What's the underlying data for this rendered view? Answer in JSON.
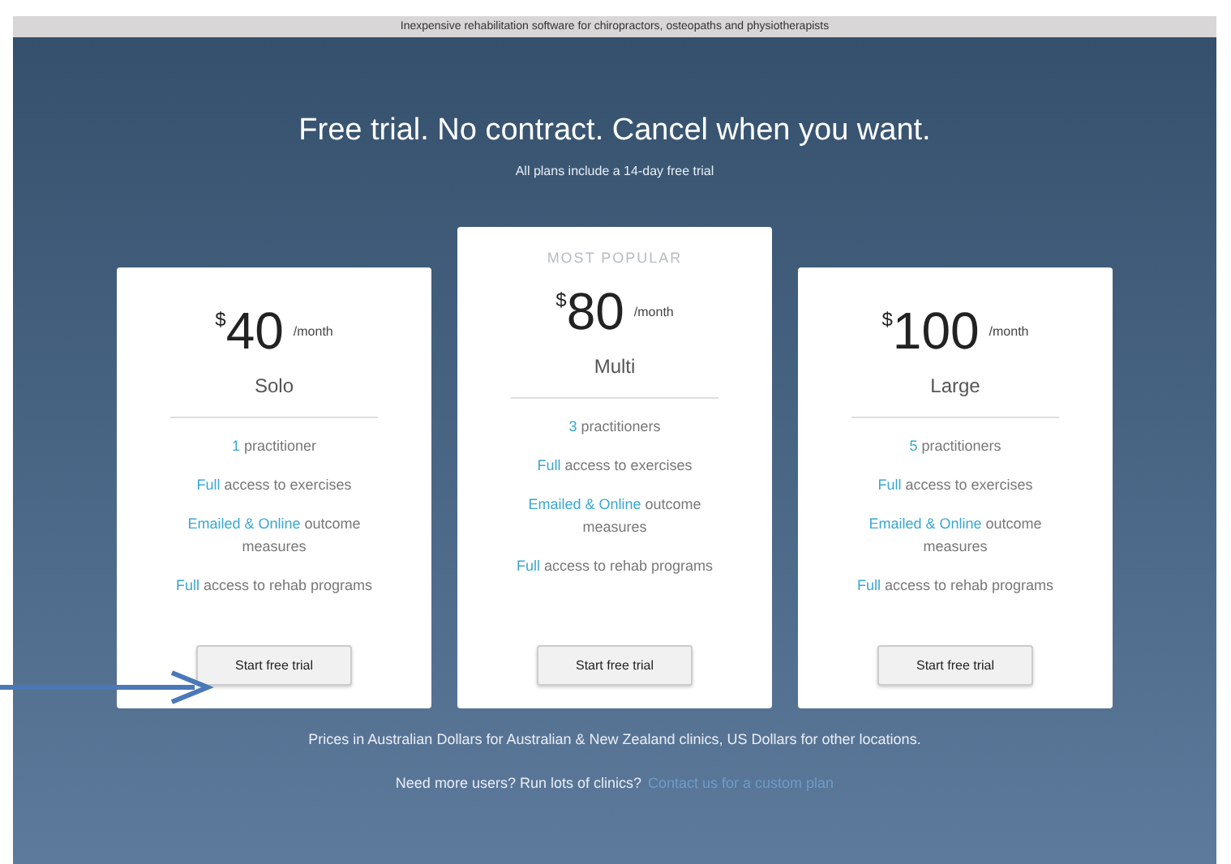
{
  "banner": {
    "text": "Inexpensive rehabilitation software for chiropractors, osteopaths and physiotherapists"
  },
  "hero": {
    "title": "Free trial. No contract. Cancel when you want.",
    "subtitle": "All plans include a 14-day free trial"
  },
  "plans": [
    {
      "currency": "$",
      "price": "40",
      "period": "/month",
      "name": "Solo",
      "featured": false,
      "features": [
        [
          {
            "text": "1",
            "highlight": true
          },
          {
            "text": " practitioner",
            "highlight": false
          }
        ],
        [
          {
            "text": "Full",
            "highlight": true
          },
          {
            "text": " access to exercises",
            "highlight": false
          }
        ],
        [
          {
            "text": "Emailed & Online",
            "highlight": true
          },
          {
            "text": " outcome measures",
            "highlight": false
          }
        ],
        [
          {
            "text": "Full",
            "highlight": true
          },
          {
            "text": " access to rehab programs",
            "highlight": false
          }
        ]
      ],
      "button": "Start free trial"
    },
    {
      "badge": "MOST POPULAR",
      "currency": "$",
      "price": "80",
      "period": "/month",
      "name": "Multi",
      "featured": true,
      "features": [
        [
          {
            "text": "3",
            "highlight": true
          },
          {
            "text": " practitioners",
            "highlight": false
          }
        ],
        [
          {
            "text": "Full",
            "highlight": true
          },
          {
            "text": " access to exercises",
            "highlight": false
          }
        ],
        [
          {
            "text": "Emailed & Online",
            "highlight": true
          },
          {
            "text": " outcome measures",
            "highlight": false
          }
        ],
        [
          {
            "text": "Full",
            "highlight": true
          },
          {
            "text": " access to rehab programs",
            "highlight": false
          }
        ]
      ],
      "button": "Start free trial"
    },
    {
      "currency": "$",
      "price": "100",
      "period": "/month",
      "name": "Large",
      "featured": false,
      "features": [
        [
          {
            "text": "5",
            "highlight": true
          },
          {
            "text": " practitioners",
            "highlight": false
          }
        ],
        [
          {
            "text": "Full",
            "highlight": true
          },
          {
            "text": " access to exercises",
            "highlight": false
          }
        ],
        [
          {
            "text": "Emailed & Online",
            "highlight": true
          },
          {
            "text": " outcome measures",
            "highlight": false
          }
        ],
        [
          {
            "text": "Full",
            "highlight": true
          },
          {
            "text": " access to rehab programs",
            "highlight": false
          }
        ]
      ],
      "button": "Start free trial"
    }
  ],
  "footer": {
    "note": "Prices in Australian Dollars for Australian & New Zealand clinics, US Dollars for other locations.",
    "question": "Need more users? Run lots of clinics?",
    "link": "Contact us for a custom plan"
  }
}
